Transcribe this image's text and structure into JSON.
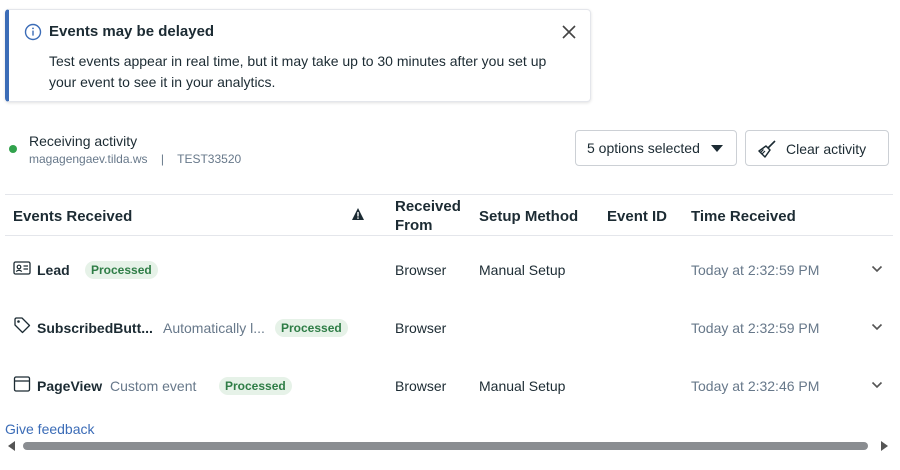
{
  "banner": {
    "title": "Events may be delayed",
    "body": "Test events appear in real time, but it may take up to 30 minutes after you set up your event to see it in your analytics.",
    "info_icon": "info-icon",
    "close_icon": "close-icon",
    "accent_color": "#3b6cb7"
  },
  "status": {
    "title": "Receiving activity",
    "domain": "magagengaev.tilda.ws",
    "separator": "|",
    "test_code": "TEST33520",
    "dot_color": "#31a24c"
  },
  "toolbar": {
    "options_label": "5 options selected",
    "clear_label": "Clear activity"
  },
  "table": {
    "headers": {
      "events_received": "Events Received",
      "received_from_1": "Received",
      "received_from_2": "From",
      "setup_method": "Setup Method",
      "event_id": "Event ID",
      "time_received": "Time Received"
    },
    "rows": [
      {
        "icon": "id-card-icon",
        "name": "Lead",
        "description": "",
        "status": "Processed",
        "received_from": "Browser",
        "setup_method": "Manual Setup",
        "event_id": "",
        "time": "Today at 2:32:59 PM"
      },
      {
        "icon": "tag-icon",
        "name": "SubscribedButt...",
        "description": "Automatically l...",
        "status": "Processed",
        "received_from": "Browser",
        "setup_method": "",
        "event_id": "",
        "time": "Today at 2:32:59 PM"
      },
      {
        "icon": "browser-window-icon",
        "name": "PageView",
        "description": "Custom event",
        "status": "Processed",
        "received_from": "Browser",
        "setup_method": "Manual Setup",
        "event_id": "",
        "time": "Today at 2:32:46 PM"
      }
    ]
  },
  "footer": {
    "feedback_label": "Give feedback"
  }
}
